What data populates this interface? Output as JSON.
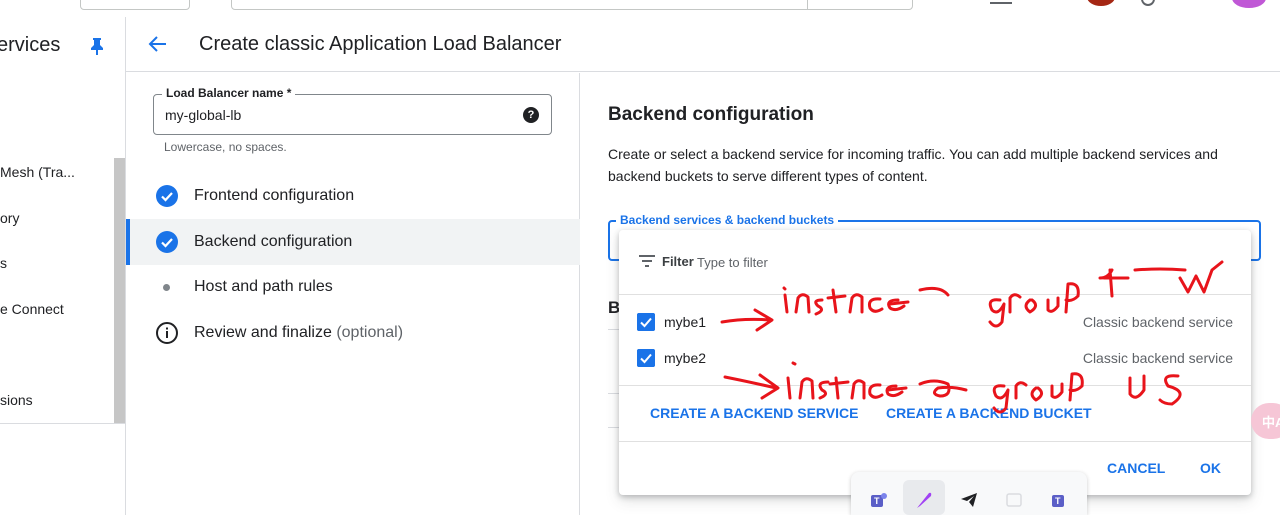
{
  "sidebar": {
    "title": "ervices",
    "items": [
      {
        "label": "Mesh (Tra...",
        "visible_prefix": ""
      },
      {
        "label": "ory"
      },
      {
        "label": "s"
      },
      {
        "label": "e Connect"
      },
      {
        "label": "sions"
      }
    ]
  },
  "header": {
    "title": "Create classic Application Load Balancer"
  },
  "name_field": {
    "label": "Load Balancer name *",
    "value": "my-global-lb",
    "hint": "Lowercase, no spaces."
  },
  "steps": [
    {
      "label": "Frontend configuration",
      "status": "done"
    },
    {
      "label": "Backend configuration",
      "status": "done"
    },
    {
      "label": "Host and path rules",
      "status": "pending"
    },
    {
      "label": "Review and finalize",
      "suffix": "(optional)",
      "status": "info"
    }
  ],
  "backend": {
    "title": "Backend configuration",
    "description": "Create or select a backend service for incoming traffic. You can add multiple backend services and backend buckets to serve different types of content.",
    "select_label": "Backend services & backend buckets",
    "behind_letter": "B"
  },
  "popup": {
    "filter_label": "Filter",
    "filter_placeholder": "Type to filter",
    "options": [
      {
        "name": "mybe1",
        "type": "Classic backend service",
        "checked": true
      },
      {
        "name": "mybe2",
        "type": "Classic backend service",
        "checked": true
      }
    ],
    "create_service": "CREATE A BACKEND SERVICE",
    "create_bucket": "CREATE A BACKEND BUCKET",
    "cancel": "CANCEL",
    "ok": "OK"
  },
  "side_bubble": "中A",
  "colors": {
    "accent": "#1a73e8",
    "ink": "#e8141b",
    "avatar1": "#a52714",
    "avatar2": "#c058d6"
  },
  "annotations": [
    {
      "text": "instance group tw",
      "kind": "handwritten"
    },
    {
      "text": "instance group us",
      "kind": "handwritten"
    }
  ]
}
